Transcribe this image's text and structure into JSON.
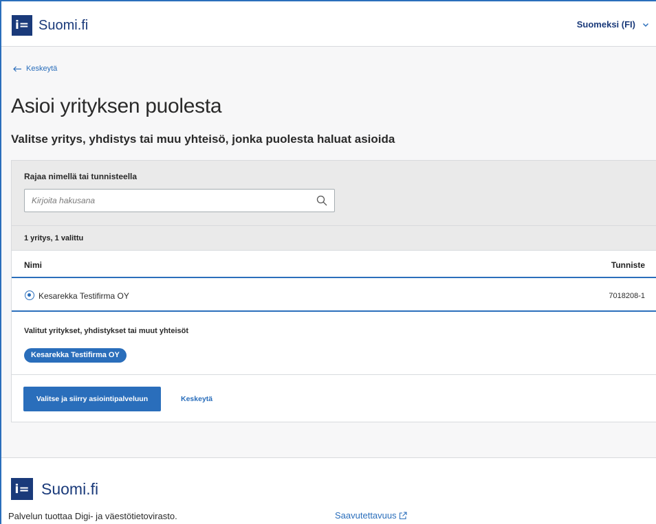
{
  "header": {
    "logo_mark": "i=",
    "logo_text": "Suomi.fi",
    "language": "Suomeksi (FI)"
  },
  "main": {
    "back_link": "Keskeytä",
    "title": "Asioi yrityksen puolesta",
    "subtitle": "Valitse yritys, yhdistys tai muu yhteisö, jonka puolesta haluat asioida",
    "filter": {
      "label": "Rajaa nimellä tai tunnisteella",
      "placeholder": "Kirjoita hakusana",
      "value": ""
    },
    "count_text": "1 yritys, 1 valittu",
    "table": {
      "columns": [
        "Nimi",
        "Tunniste"
      ],
      "rows": [
        {
          "name": "Kesarekka Testifirma OY",
          "id": "7018208-1",
          "selected": true
        }
      ]
    },
    "selected": {
      "label": "Valitut yritykset, yhdistykset tai muut yhteisöt",
      "chips": [
        "Kesarekka Testifirma OY"
      ]
    },
    "actions": {
      "primary": "Valitse ja siirry asiointipalveluun",
      "cancel": "Keskeytä"
    }
  },
  "footer": {
    "logo_mark": "i=",
    "logo_text": "Suomi.fi",
    "provider_text": "Palvelun tuottaa Digi- ja väestötietovirasto.",
    "accessibility_link": "Saavutettavuus"
  },
  "colors": {
    "brand": "#1a3a7a",
    "accent": "#2a6ebb",
    "panel_gray": "#eaeaea"
  }
}
